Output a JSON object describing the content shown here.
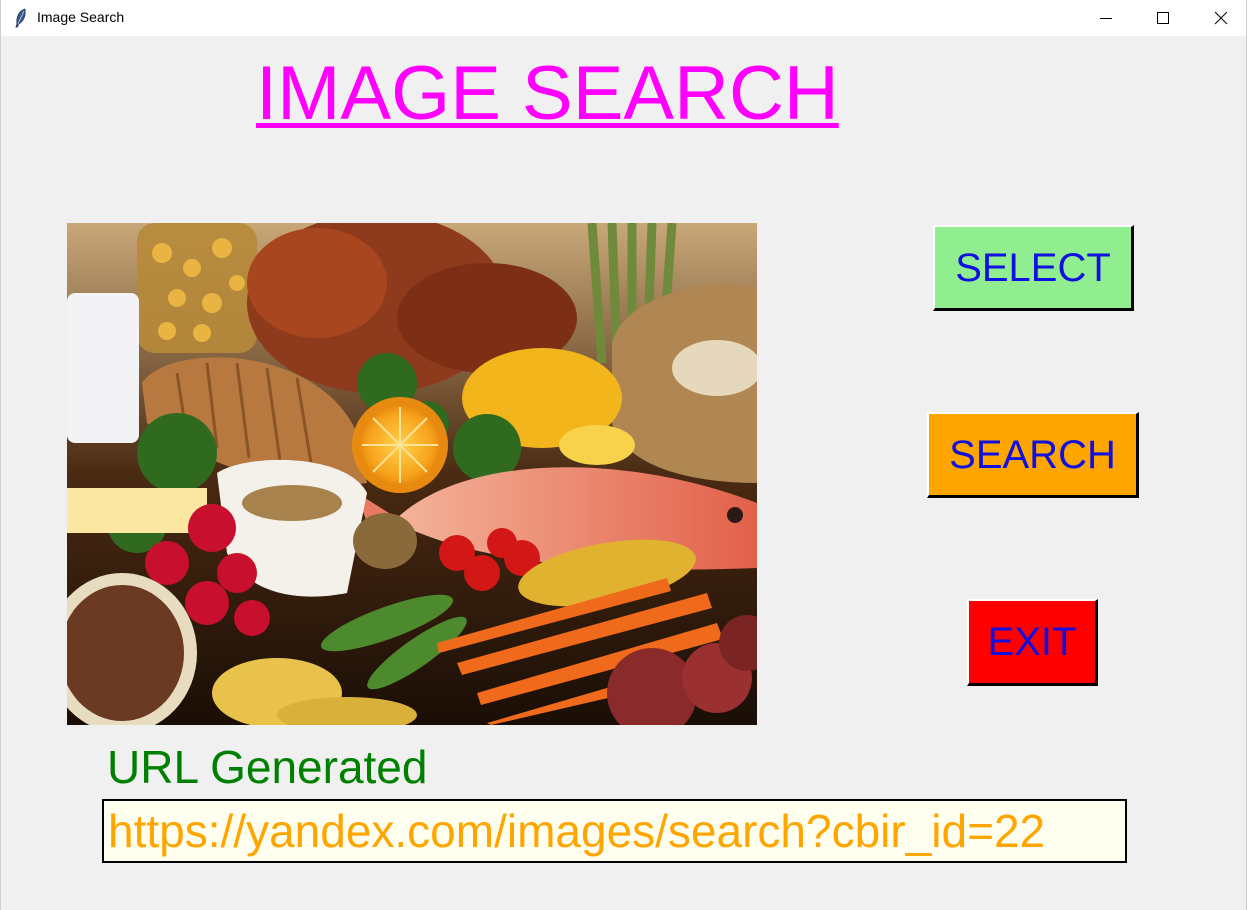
{
  "window": {
    "title": "Image Search",
    "controls": [
      "minimize-icon",
      "maximize-icon",
      "close-icon"
    ]
  },
  "main": {
    "heading": "IMAGE SEARCH",
    "image": {
      "description_icon": "food-photo",
      "alt": ""
    },
    "buttons": {
      "select_label": "SELECT",
      "search_label": "SEARCH",
      "exit_label": "EXIT"
    },
    "url_label": "URL Generated",
    "url_value": "https://yandex.com/images/search?cbir_id=22"
  },
  "colors": {
    "heading": "#ff00ff",
    "select_bg": "#90ee90",
    "search_bg": "#ffa500",
    "exit_bg": "#ff0000",
    "button_text": "#1010e0",
    "url_label": "#008000",
    "url_text": "#ffa500",
    "url_bg": "#fffff0"
  }
}
